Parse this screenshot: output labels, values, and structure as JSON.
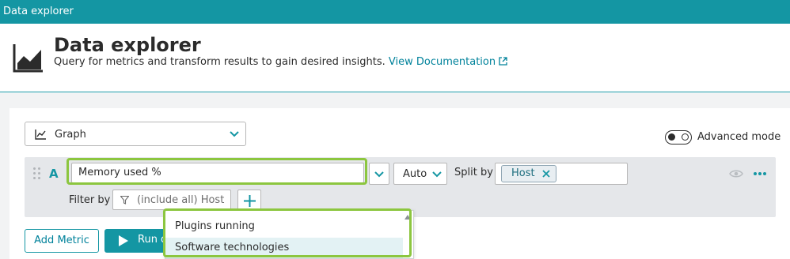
{
  "app": {
    "window_title": "Data explorer"
  },
  "header": {
    "title": "Data explorer",
    "subtitle": "Query for metrics and transform results to gain desired insights.",
    "doc_link": "View Documentation"
  },
  "visualization": {
    "selected": "Graph"
  },
  "advanced_mode": {
    "label": "Advanced mode",
    "enabled": true
  },
  "query": {
    "letter": "A",
    "metric": "Memory used %",
    "aggregation": "Auto",
    "split_by_label": "Split by",
    "split_by_tags": [
      "Host"
    ],
    "filter_label": "Filter by",
    "filter_placeholder": "(include all)  Host"
  },
  "dropdown": {
    "items": [
      "Plugins running",
      "Software technologies"
    ],
    "selected_index": 1
  },
  "actions": {
    "add_metric": "Add Metric",
    "run_query": "Run q"
  },
  "colors": {
    "accent": "#1496a3",
    "highlight": "#8cc63f",
    "link": "#00829b"
  }
}
